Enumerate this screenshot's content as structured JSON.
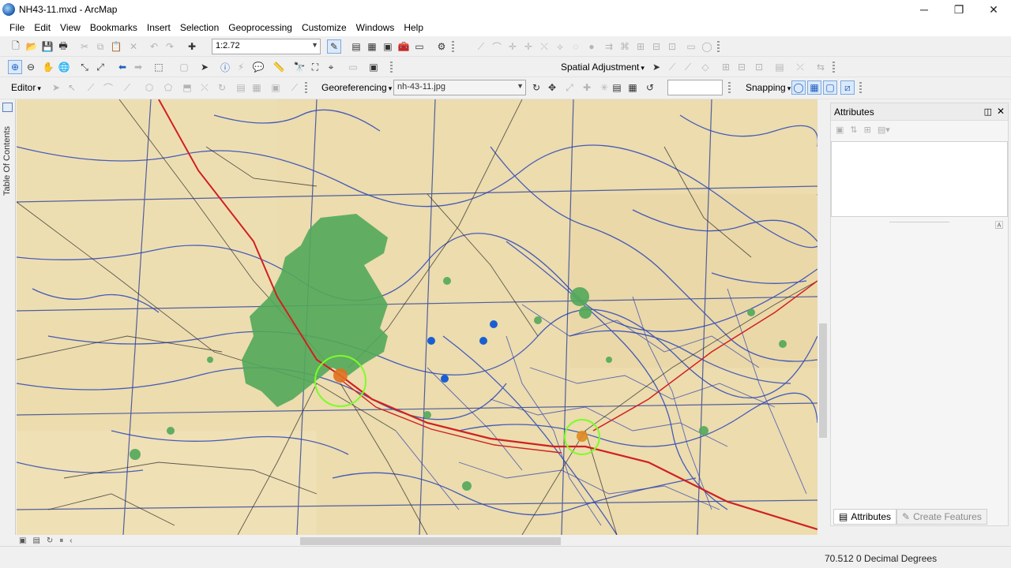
{
  "window": {
    "title": "NH43-11.mxd - ArcMap",
    "minimize": "─",
    "maximize": "❐",
    "close": "✕"
  },
  "menu": [
    "File",
    "Edit",
    "View",
    "Bookmarks",
    "Insert",
    "Selection",
    "Geoprocessing",
    "Customize",
    "Windows",
    "Help"
  ],
  "standard_toolbar": {
    "scale_value": "1:2.72"
  },
  "tools_toolbar": {
    "spatial_adjustment_label": "Spatial Adjustment"
  },
  "editor_toolbar": {
    "editor_label": "Editor",
    "georeferencing_label": "Georeferencing",
    "layer_value": "nh-43-11.jpg",
    "snapping_label": "Snapping"
  },
  "toc": {
    "label": "Table Of Contents"
  },
  "attributes": {
    "title": "Attributes",
    "tab_attributes": "Attributes",
    "tab_create_features": "Create Features"
  },
  "status": {
    "coords": "70.512  0 Decimal Degrees"
  },
  "colors": {
    "map_paper": "#ecdcae",
    "forest": "#52a85a",
    "rail": "#d12020",
    "control_point": "#1a5fd0",
    "highlight": "#7dfc2a"
  },
  "icons": [
    "arcmap-app-icon",
    "zoom-in-icon",
    "zoom-out-icon",
    "pan-icon",
    "full-extent-icon",
    "identify-icon",
    "select-icon",
    "snapping-icon"
  ]
}
